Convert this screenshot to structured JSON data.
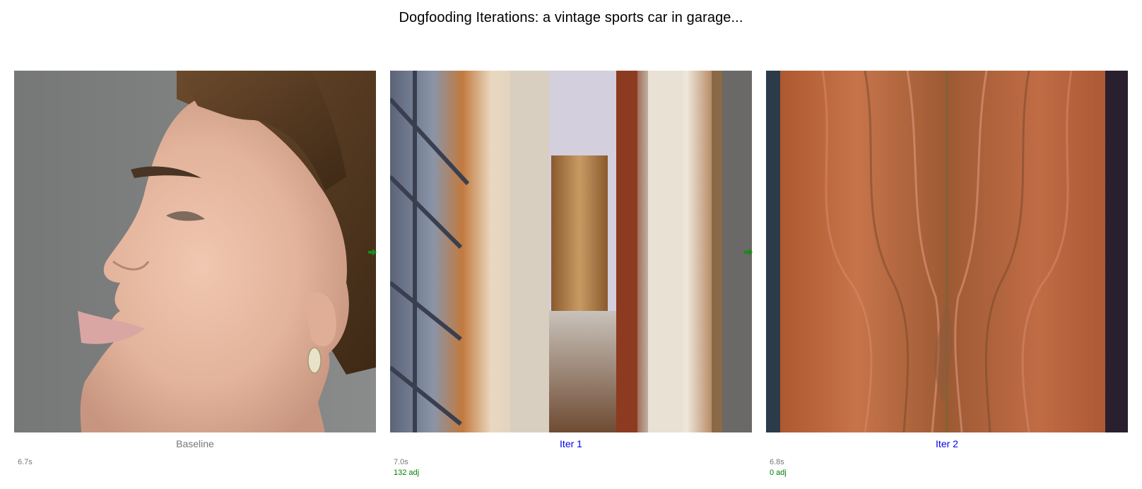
{
  "title": "Dogfooding Iterations: a vintage sports car in garage...",
  "panels": [
    {
      "label": "Baseline",
      "time": "6.7s",
      "adj": "",
      "image": "woman-profile-portrait",
      "label_color": "#777777"
    },
    {
      "label": "Iter 1",
      "time": "7.0s",
      "adj": "132 adj",
      "image": "hallway-curtains-interior",
      "label_color": "#0000ee"
    },
    {
      "label": "Iter 2",
      "time": "6.8s",
      "adj": "0 adj",
      "image": "wood-grain-texture",
      "label_color": "#0000ee"
    }
  ],
  "colors": {
    "baseline_label": "#777777",
    "iter_label": "#0000ee",
    "time_text": "#777777",
    "adj_text": "#008000",
    "arrow": "#1a8a1a"
  },
  "icons": [
    "arrow-right-icon",
    "arrow-right-icon"
  ]
}
